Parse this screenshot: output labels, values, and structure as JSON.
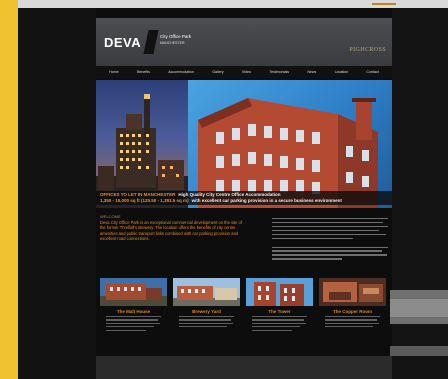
{
  "header": {
    "logo_word": "DEVA",
    "logo_title": "City Office Park",
    "logo_tagline": "MANCHESTER",
    "partner_logo": "PIGHCROSS"
  },
  "nav": {
    "items": [
      "Home",
      "Benefits",
      "Accommodation",
      "Gallery",
      "Video",
      "Testimonials",
      "News",
      "Location",
      "Contact"
    ]
  },
  "hero": {
    "caption_orange": "OFFICES TO LET IN MANCHESTER",
    "caption_white": "High Quality City Centre Office Accommodation",
    "caption_orange_2": "1,350 - 15,000 sq ft (125.50 - 1,393.5 sq m)",
    "caption_white_2": "with excellent car parking provision in a secure business environment"
  },
  "section": {
    "label": "WELCOME",
    "intro": "Deva City Office Park is an exceptional commercial development on the site of the former Threlfall's Brewery. The location offers the benefits of city centre amenities and public transport links combined with car parking provision and excellent road connections."
  },
  "cards": [
    {
      "title": "The Malt House",
      "image": "malt-house-photo",
      "text_lines": 5
    },
    {
      "title": "Brewery Yard",
      "image": "brewery-yard-photo",
      "text_lines": 4
    },
    {
      "title": "The Tower",
      "image": "the-tower-photo",
      "text_lines": 5
    },
    {
      "title": "The Copper Room",
      "image": "copper-room-photo",
      "text_lines": 4
    }
  ],
  "colors": {
    "accent_orange": "#e8922a",
    "brand_yellow": "#f0c230",
    "header_grey": "#4b4d50",
    "page_black": "#0d0d0d"
  }
}
